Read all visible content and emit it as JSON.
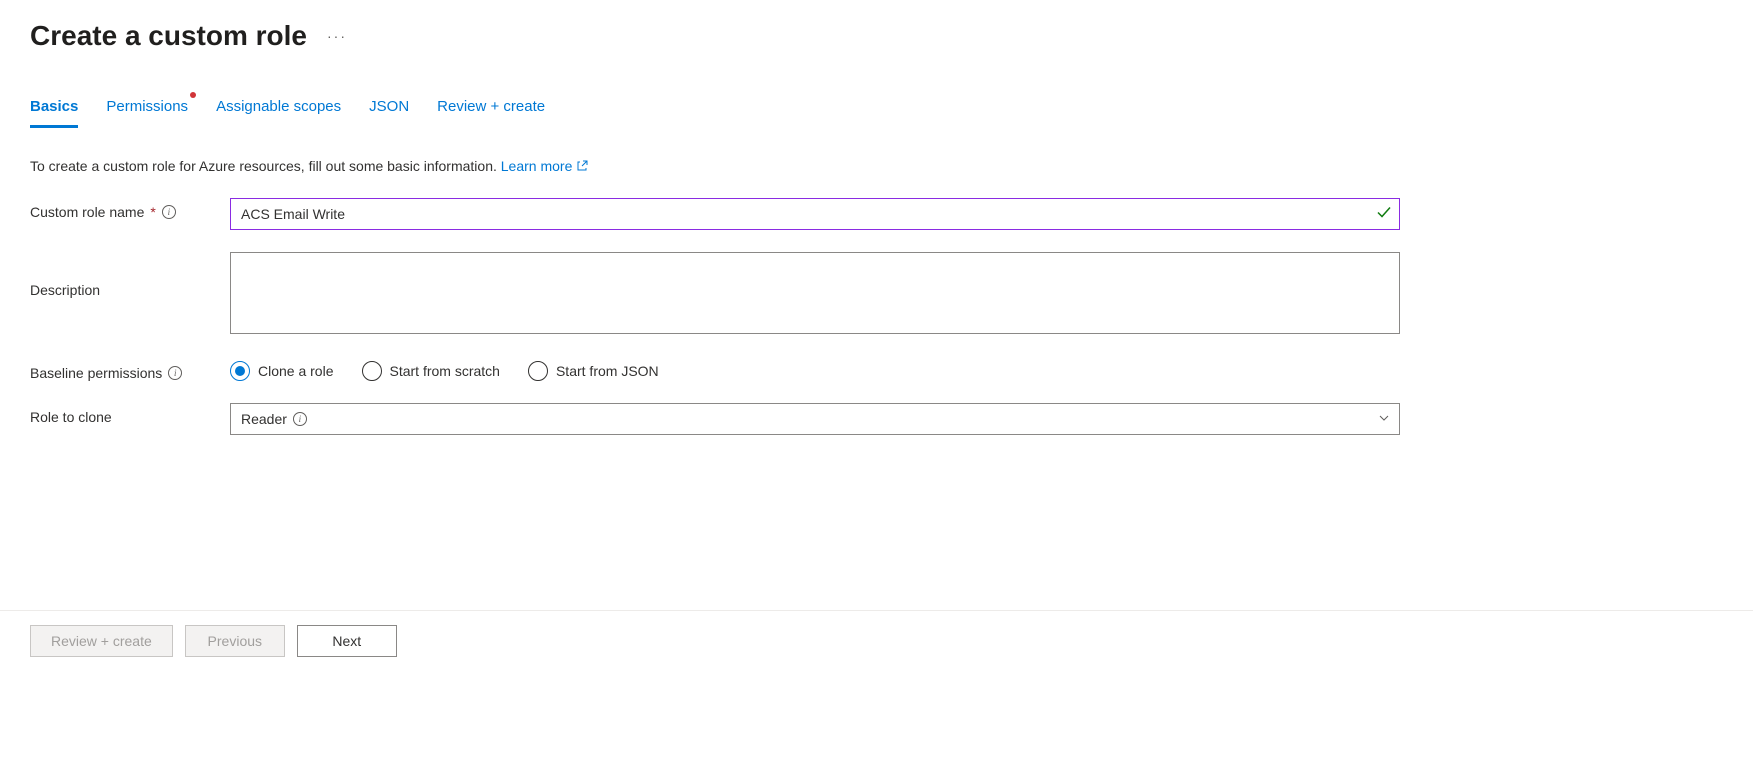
{
  "header": {
    "title": "Create a custom role"
  },
  "tabs": [
    {
      "label": "Basics",
      "active": true,
      "dot": false
    },
    {
      "label": "Permissions",
      "active": false,
      "dot": true
    },
    {
      "label": "Assignable scopes",
      "active": false,
      "dot": false
    },
    {
      "label": "JSON",
      "active": false,
      "dot": false
    },
    {
      "label": "Review + create",
      "active": false,
      "dot": false
    }
  ],
  "intro": {
    "text": "To create a custom role for Azure resources, fill out some basic information. ",
    "learn_more": "Learn more"
  },
  "fields": {
    "name_label": "Custom role name",
    "name_value": "ACS Email Write",
    "description_label": "Description",
    "description_value": "",
    "baseline_label": "Baseline permissions",
    "baseline_options": {
      "clone": "Clone a role",
      "scratch": "Start from scratch",
      "json": "Start from JSON"
    },
    "baseline_selected": "clone",
    "clone_label": "Role to clone",
    "clone_value": "Reader"
  },
  "footer": {
    "review": "Review + create",
    "previous": "Previous",
    "next": "Next"
  }
}
